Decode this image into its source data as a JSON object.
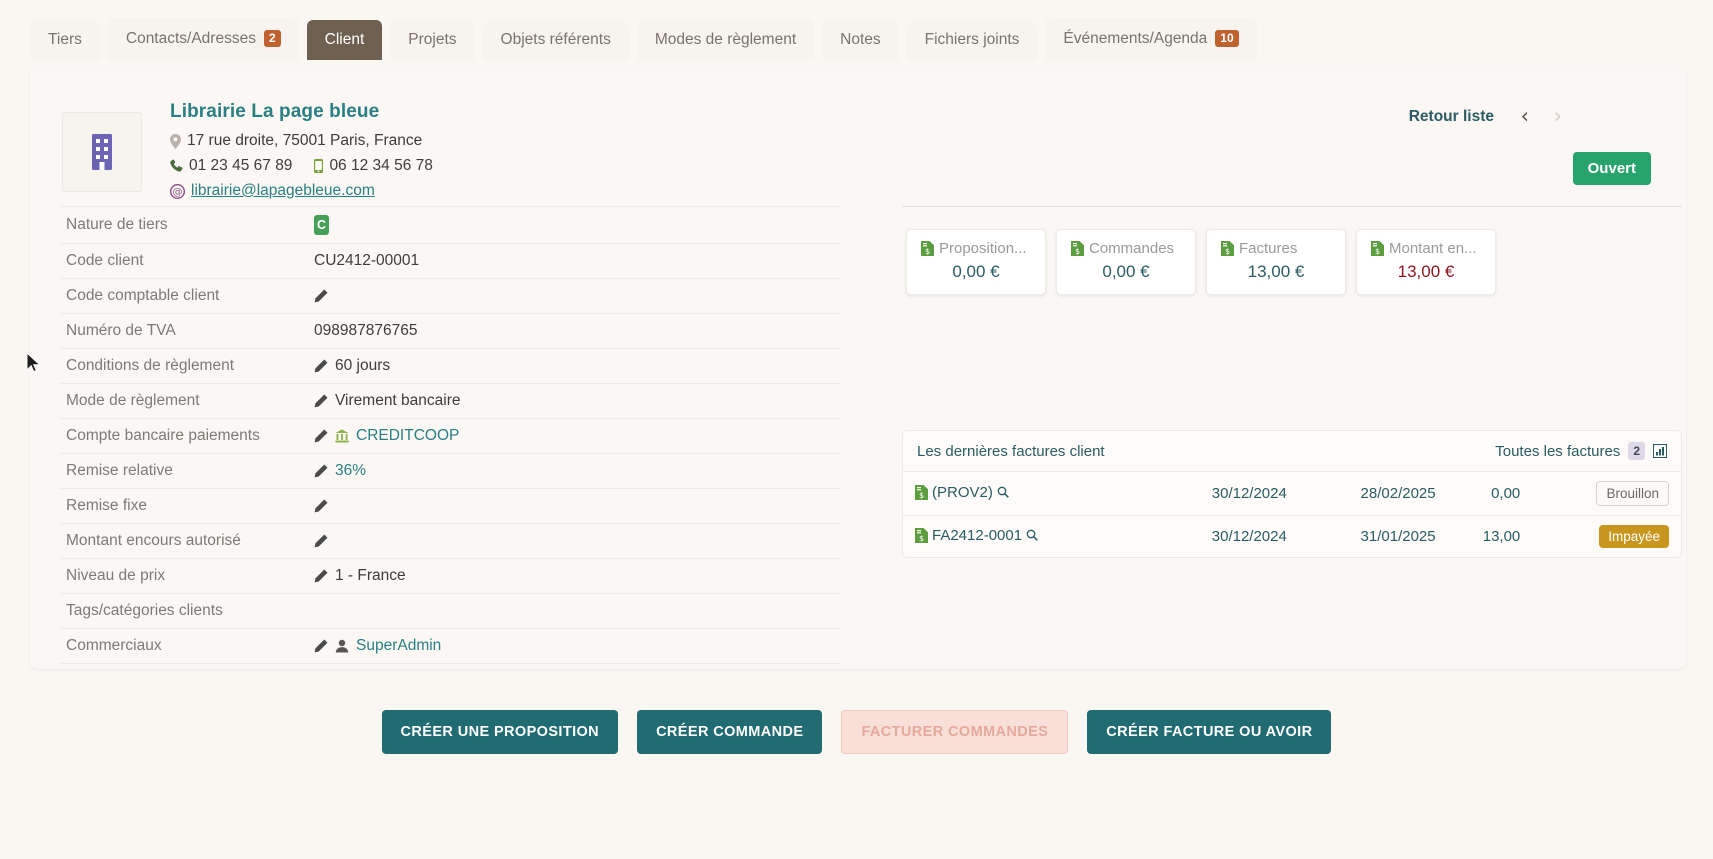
{
  "tabs": [
    {
      "label": "Tiers",
      "badge": null,
      "active": false
    },
    {
      "label": "Contacts/Adresses",
      "badge": "2",
      "active": false
    },
    {
      "label": "Client",
      "badge": null,
      "active": true
    },
    {
      "label": "Projets",
      "badge": null,
      "active": false
    },
    {
      "label": "Objets référents",
      "badge": null,
      "active": false
    },
    {
      "label": "Modes de règlement",
      "badge": null,
      "active": false
    },
    {
      "label": "Notes",
      "badge": null,
      "active": false
    },
    {
      "label": "Fichiers joints",
      "badge": null,
      "active": false
    },
    {
      "label": "Événements/Agenda",
      "badge": "10",
      "active": false
    }
  ],
  "header": {
    "org_name": "Librairie La page bleue",
    "address": "17 rue droite, 75001 Paris, France",
    "phone": "01 23 45 67 89",
    "mobile": "06 12 34 56 78",
    "email": "librairie@lapagebleue.com",
    "back_link": "Retour liste",
    "status_label": "Ouvert",
    "status_color": "#27a36b"
  },
  "details": [
    {
      "label": "Nature de tiers",
      "value": "",
      "badge": "C",
      "pencil": false,
      "link": false
    },
    {
      "label": "Code client",
      "value": "CU2412-00001",
      "pencil": false,
      "link": false
    },
    {
      "label": "Code comptable client",
      "value": "",
      "pencil": true,
      "link": false
    },
    {
      "label": "Numéro de TVA",
      "value": "098987876765",
      "pencil": false,
      "link": false
    },
    {
      "label": "Conditions de règlement",
      "value": "60 jours",
      "pencil": true,
      "link": false
    },
    {
      "label": "Mode de règlement",
      "value": "Virement bancaire",
      "pencil": true,
      "link": false
    },
    {
      "label": "Compte bancaire paiements",
      "value": "CREDITCOOP",
      "pencil": true,
      "link": true,
      "icon": "bank-icon"
    },
    {
      "label": "Remise relative",
      "value": "36%",
      "pencil": true,
      "link": true
    },
    {
      "label": "Remise fixe",
      "value": "",
      "pencil": true,
      "link": false
    },
    {
      "label": "Montant encours autorisé",
      "value": "",
      "pencil": true,
      "link": false
    },
    {
      "label": "Niveau de prix",
      "value": "1 - France",
      "pencil": true,
      "link": false
    },
    {
      "label": "Tags/catégories clients",
      "value": "",
      "pencil": false,
      "link": false
    },
    {
      "label": "Commerciaux",
      "value": "SuperAdmin",
      "pencil": true,
      "link": true,
      "icon": "user-icon"
    }
  ],
  "stats": [
    {
      "title": "Proposition...",
      "amount": "0,00 €",
      "negative": false
    },
    {
      "title": "Commandes",
      "amount": "0,00 €",
      "negative": false
    },
    {
      "title": "Factures",
      "amount": "13,00 €",
      "negative": false
    },
    {
      "title": "Montant en...",
      "amount": "13,00 €",
      "negative": true
    }
  ],
  "invoices": {
    "title": "Les dernières factures client",
    "all_link": "Toutes les factures",
    "count": "2",
    "rows": [
      {
        "ref": "(PROV2)",
        "date": "30/12/2024",
        "due": "28/02/2025",
        "amount": "0,00",
        "status": "Brouillon",
        "status_kind": "draft"
      },
      {
        "ref": "FA2412-0001",
        "date": "30/12/2024",
        "due": "31/01/2025",
        "amount": "13,00",
        "status": "Impayée",
        "status_kind": "unpaid"
      }
    ]
  },
  "actions": [
    {
      "label": "Créer une proposition",
      "disabled": false
    },
    {
      "label": "Créer commande",
      "disabled": false
    },
    {
      "label": "Facturer commandes",
      "disabled": true
    },
    {
      "label": "Créer facture ou avoir",
      "disabled": false
    }
  ]
}
